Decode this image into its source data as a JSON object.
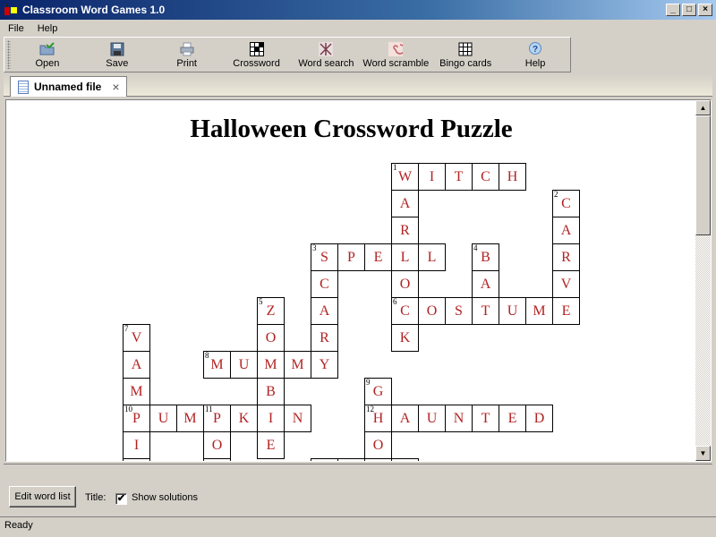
{
  "window": {
    "title": "Classroom Word Games 1.0",
    "controls": {
      "minimize": "_",
      "maximize": "□",
      "close": "×"
    }
  },
  "menu": [
    {
      "label": "File"
    },
    {
      "label": "Help"
    }
  ],
  "toolbar": [
    {
      "label": "Open",
      "icon": "open-folder-icon"
    },
    {
      "label": "Save",
      "icon": "floppy-disk-icon"
    },
    {
      "label": "Print",
      "icon": "printer-icon"
    },
    {
      "label": "Crossword",
      "icon": "crossword-icon"
    },
    {
      "label": "Word search",
      "icon": "word-search-icon"
    },
    {
      "label": "Word scramble",
      "icon": "word-scramble-icon"
    },
    {
      "label": "Bingo cards",
      "icon": "bingo-grid-icon"
    },
    {
      "label": "Help",
      "icon": "help-bubble-icon"
    }
  ],
  "tabs": [
    {
      "label": "Unnamed file",
      "close": "×"
    }
  ],
  "puzzle": {
    "title": "Halloween Crossword Puzzle",
    "solution_color": "#b22222",
    "words": [
      {
        "number": 1,
        "direction": "across",
        "answer": "WITCH",
        "row": 0,
        "col": 10
      },
      {
        "number": 1,
        "direction": "down",
        "answer": "WARLOCK",
        "row": 0,
        "col": 10
      },
      {
        "number": 2,
        "direction": "down",
        "answer": "CARVE",
        "row": 1,
        "col": 16
      },
      {
        "number": 3,
        "direction": "across",
        "answer": "SPELL",
        "row": 3,
        "col": 7
      },
      {
        "number": 3,
        "direction": "down",
        "answer": "SCARY",
        "row": 3,
        "col": 7
      },
      {
        "number": 4,
        "direction": "down",
        "answer": "BAT",
        "row": 3,
        "col": 13
      },
      {
        "number": 5,
        "direction": "down",
        "answer": "ZOMBIE",
        "row": 5,
        "col": 5
      },
      {
        "number": 6,
        "direction": "across",
        "answer": "COSTUME",
        "row": 5,
        "col": 10
      },
      {
        "number": 7,
        "direction": "down",
        "answer": "VAMPI",
        "row": 6,
        "col": 0
      },
      {
        "number": 8,
        "direction": "across",
        "answer": "MUMMY",
        "row": 7,
        "col": 3
      },
      {
        "number": 9,
        "direction": "down",
        "answer": "GHO",
        "row": 8,
        "col": 9
      },
      {
        "number": 10,
        "direction": "across",
        "answer": "PUMPKIN",
        "row": 9,
        "col": 0
      },
      {
        "number": 11,
        "direction": "down",
        "answer": "PO",
        "row": 9,
        "col": 3
      },
      {
        "number": 12,
        "direction": "across",
        "answer": "HAUNTED",
        "row": 9,
        "col": 9
      }
    ],
    "partial_cells": [
      {
        "row": 11,
        "col": 0
      },
      {
        "row": 11,
        "col": 3
      },
      {
        "row": 11,
        "col": 7
      },
      {
        "row": 11,
        "col": 8
      },
      {
        "row": 11,
        "col": 9
      },
      {
        "row": 11,
        "col": 10
      }
    ]
  },
  "bottom": {
    "edit_button": "Edit word list",
    "title_label": "Title:",
    "show_solutions_label": "Show solutions",
    "show_solutions_checked": true,
    "check_glyph": "✔"
  },
  "status": "Ready"
}
